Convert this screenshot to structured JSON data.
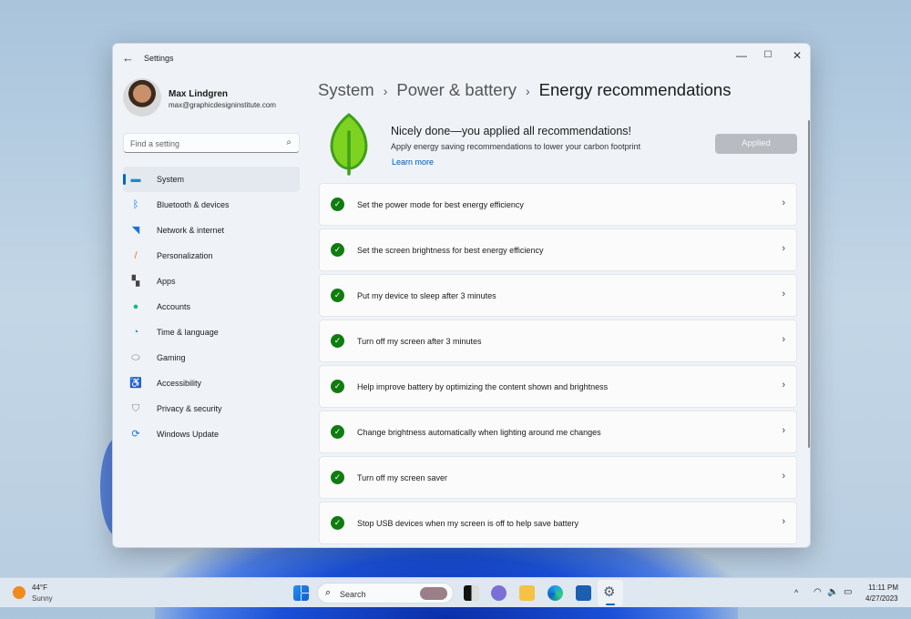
{
  "window": {
    "title": "Settings",
    "back_icon": "arrow-left-icon",
    "minimize": "—",
    "maximize": "☐",
    "close": "✕"
  },
  "user": {
    "name": "Max Lindgren",
    "email": "max@graphicdesigninstitute.com"
  },
  "search": {
    "placeholder": "Find a setting",
    "icon": "search-icon"
  },
  "nav": [
    {
      "label": "System",
      "icon": "monitor-icon",
      "color": "#1a8ad6",
      "glyph": "▬",
      "selected": true
    },
    {
      "label": "Bluetooth & devices",
      "icon": "bluetooth-icon",
      "color": "#0a6fd8",
      "glyph": "ᛒ"
    },
    {
      "label": "Network & internet",
      "icon": "wifi-icon",
      "color": "#1a73d9",
      "glyph": "◥"
    },
    {
      "label": "Personalization",
      "icon": "brush-icon",
      "color": "#e07a2e",
      "glyph": "/"
    },
    {
      "label": "Apps",
      "icon": "apps-icon",
      "color": "#444",
      "glyph": "▚"
    },
    {
      "label": "Accounts",
      "icon": "person-icon",
      "color": "#1fb58f",
      "glyph": "●"
    },
    {
      "label": "Time & language",
      "icon": "globe-clock-icon",
      "color": "#2a8ad8",
      "glyph": "◔"
    },
    {
      "label": "Gaming",
      "icon": "gamepad-icon",
      "color": "#777",
      "glyph": "⬭"
    },
    {
      "label": "Accessibility",
      "icon": "accessibility-icon",
      "color": "#1a73d9",
      "glyph": "♿"
    },
    {
      "label": "Privacy & security",
      "icon": "shield-icon",
      "color": "#888",
      "glyph": "⛉"
    },
    {
      "label": "Windows Update",
      "icon": "update-icon",
      "color": "#1a73d9",
      "glyph": "⟳"
    }
  ],
  "breadcrumb": [
    "System",
    "Power & battery",
    "Energy recommendations"
  ],
  "hero": {
    "title": "Nicely done—you applied all recommendations!",
    "subtitle": "Apply energy saving recommendations to lower your carbon footprint",
    "link": "Learn more",
    "button": "Applied",
    "icon": "leaf-icon"
  },
  "recommendations": [
    "Set the power mode for best energy efficiency",
    "Set the screen brightness for best energy efficiency",
    "Put my device to sleep after 3 minutes",
    "Turn off my screen after 3 minutes",
    "Help improve battery by optimizing the content shown and brightness",
    "Change brightness automatically when lighting around me changes",
    "Turn off my screen saver",
    "Stop USB devices when my screen is off to help save battery"
  ],
  "taskbar": {
    "weather_temp": "44°F",
    "weather_desc": "Sunny",
    "search": "Search",
    "time": "11:11 PM",
    "date": "4/27/2023",
    "tray": [
      "^",
      "wifi-icon",
      "volume-icon",
      "battery-icon"
    ]
  }
}
